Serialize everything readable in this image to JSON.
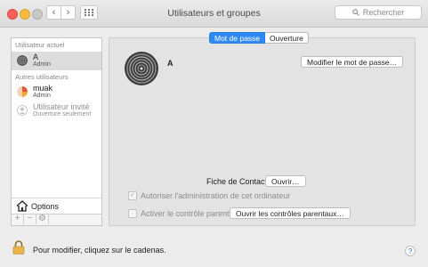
{
  "window": {
    "title": "Utilisateurs et groupes"
  },
  "search": {
    "placeholder": "Rechercher"
  },
  "sidebar": {
    "current_header": "Utilisateur actuel",
    "current_user": {
      "name": "A",
      "role": "Admin"
    },
    "others_header": "Autres utilisateurs",
    "others": [
      {
        "name": "muak",
        "role": "Admin"
      },
      {
        "name": "Utilisateur invité",
        "role": "Ouverture seulement"
      }
    ],
    "options_label": "Options",
    "add_symbol": "+",
    "remove_symbol": "−"
  },
  "tabs": {
    "password": "Mot de passe",
    "login": "Ouverture"
  },
  "main": {
    "username": "A",
    "change_password_button": "Modifier le mot de passe…",
    "contacts_label": "Fiche de Contacts :",
    "open_button": "Ouvrir…",
    "allow_admin_label": "Autoriser l'administration de cet ordinateur",
    "parental_label": "Activer le contrôle parental",
    "open_parental_button": "Ouvrir les contrôles parentaux…"
  },
  "footer": {
    "lock_text": "Pour modifier, cliquez sur le cadenas.",
    "help": "?"
  },
  "colors": {
    "accent": "#2d8af5"
  }
}
